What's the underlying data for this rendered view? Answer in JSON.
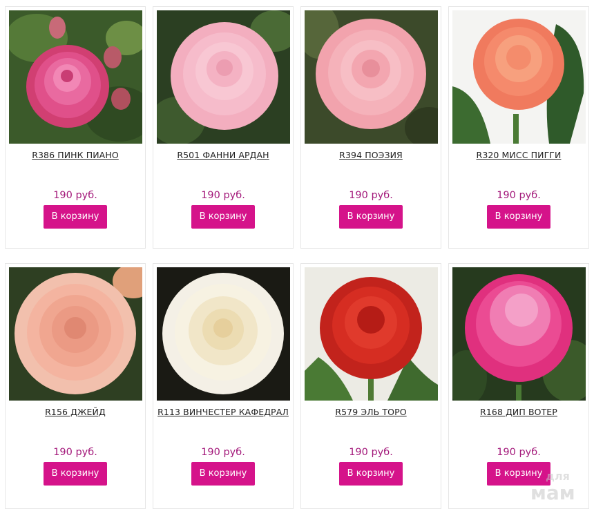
{
  "products": [
    {
      "name": "R386 ПИНК ПИАНО",
      "price": "190 руб.",
      "button": "В корзину"
    },
    {
      "name": "R501 ФАННИ АРДАН",
      "price": "190 руб.",
      "button": "В корзину"
    },
    {
      "name": "R394 ПОЭЗИЯ",
      "price": "190 руб.",
      "button": "В корзину"
    },
    {
      "name": "R320 МИСС ПИГГИ",
      "price": "190 руб.",
      "button": "В корзину"
    },
    {
      "name": "R156 ДЖЕЙД",
      "price": "190 руб.",
      "button": "В корзину"
    },
    {
      "name": "R113 ВИНЧЕСТЕР КАФЕДРАЛ",
      "price": "190 руб.",
      "button": "В корзину"
    },
    {
      "name": "R579 ЭЛЬ ТОРО",
      "price": "190 руб.",
      "button": "В корзину"
    },
    {
      "name": "R168 ДИП ВОТЕР",
      "price": "190 руб.",
      "button": "В корзину"
    }
  ],
  "watermark": {
    "line1": "для",
    "line2": "мам"
  },
  "colors": {
    "price": "#a3187a",
    "button": "#d5138a",
    "border": "#e6e6e6"
  }
}
